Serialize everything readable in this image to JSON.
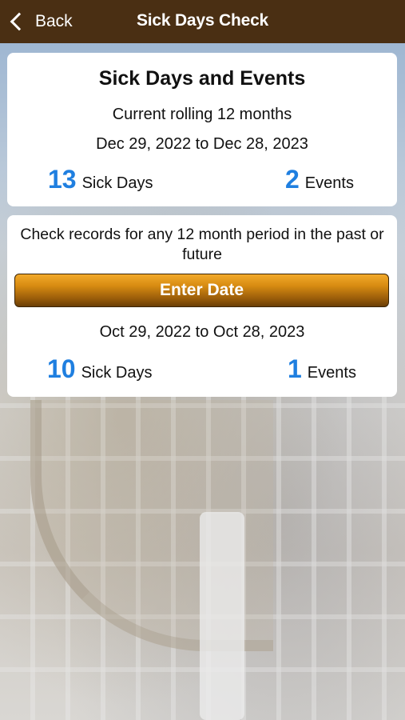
{
  "nav": {
    "back_label": "Back",
    "title": "Sick Days Check"
  },
  "summary": {
    "title": "Sick Days and Events",
    "subtitle": "Current rolling 12 months",
    "date_range": "Dec 29, 2022 to Dec 28, 2023",
    "sick_days_count": "13",
    "sick_days_label": "Sick Days",
    "events_count": "2",
    "events_label": "Events"
  },
  "check": {
    "description": "Check records for any 12 month period in the past or future",
    "button_label": "Enter Date",
    "date_range": "Oct 29, 2022 to Oct 28, 2023",
    "sick_days_count": "10",
    "sick_days_label": "Sick Days",
    "events_count": "1",
    "events_label": "Events"
  },
  "colors": {
    "nav_bar": "#4a2f13",
    "accent_number": "#1f7fe0",
    "button_gold": "#d88c12"
  },
  "icons": {
    "back": "chevron-left-icon"
  }
}
